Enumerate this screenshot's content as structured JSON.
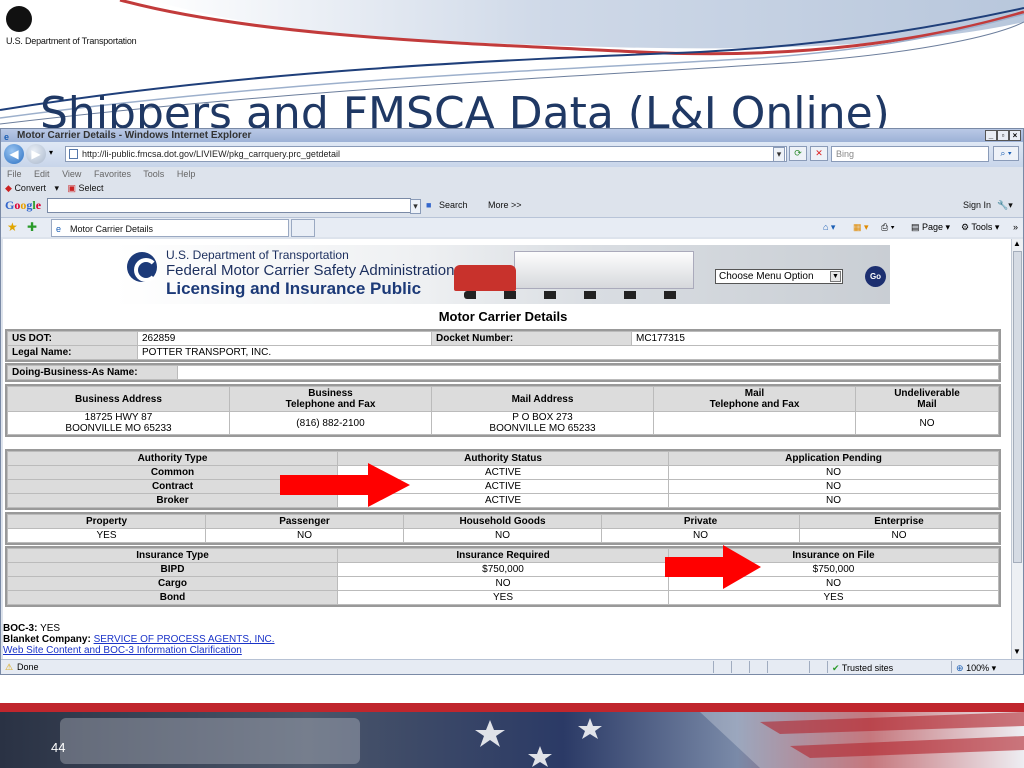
{
  "slide": {
    "org_label": "U.S. Department of Transportation",
    "title": "Shippers and FMSCA Data (L&I Online)",
    "page_number": "44"
  },
  "window": {
    "title": "Motor Carrier Details - Windows Internet Explorer",
    "url": "http://li-public.fmcsa.dot.gov/LIVIEW/pkg_carrquery.prc_getdetail",
    "search_placeholder": "Bing",
    "menu": [
      "File",
      "Edit",
      "View",
      "Favorites",
      "Tools",
      "Help"
    ],
    "convert_label": "Convert",
    "select_label": "Select",
    "google_logo": "Google",
    "google_search_label": "Search",
    "more_label": "More >>",
    "sign_in_label": "Sign In",
    "tab_label": "Motor Carrier Details",
    "page_menu_label": "Page",
    "tools_menu_label": "Tools",
    "status_done": "Done",
    "status_zone": "Trusted sites",
    "zoom": "100%"
  },
  "banner": {
    "dept": "U.S. Department of Transportation",
    "agency": "Federal Motor Carrier Safety Administration",
    "subtitle": "Licensing and Insurance Public",
    "menu_select": "Choose Menu Option",
    "go_label": "Go"
  },
  "page": {
    "heading": "Motor Carrier Details",
    "us_dot_label": "US DOT:",
    "us_dot": "262859",
    "docket_label": "Docket Number:",
    "docket": "MC177315",
    "legal_name_label": "Legal Name:",
    "legal_name": "POTTER TRANSPORT, INC.",
    "dba_label": "Doing-Business-As Name:",
    "dba": "",
    "address_headers": [
      "Business Address",
      "Business\nTelephone and Fax",
      "Mail Address",
      "Mail\nTelephone and Fax",
      "Undeliverable\nMail"
    ],
    "business_address": [
      "18725 HWY 87",
      "BOONVILLE MO 65233"
    ],
    "business_phone": "(816) 882-2100",
    "mail_address": [
      "P O BOX 273",
      "BOONVILLE MO 65233"
    ],
    "mail_phone": "",
    "undeliverable": "NO",
    "authority_headers": [
      "Authority Type",
      "Authority Status",
      "Application Pending"
    ],
    "authority_rows": [
      {
        "type": "Common",
        "status": "ACTIVE",
        "pending": "NO"
      },
      {
        "type": "Contract",
        "status": "ACTIVE",
        "pending": "NO"
      },
      {
        "type": "Broker",
        "status": "ACTIVE",
        "pending": "NO"
      }
    ],
    "cargo_headers": [
      "Property",
      "Passenger",
      "Household Goods",
      "Private",
      "Enterprise"
    ],
    "cargo_values": [
      "YES",
      "NO",
      "NO",
      "NO",
      "NO"
    ],
    "insurance_headers": [
      "Insurance Type",
      "Insurance Required",
      "Insurance on File"
    ],
    "insurance_rows": [
      {
        "type": "BIPD",
        "required": "$750,000",
        "on_file": "$750,000"
      },
      {
        "type": "Cargo",
        "required": "NO",
        "on_file": "NO"
      },
      {
        "type": "Bond",
        "required": "YES",
        "on_file": "YES"
      }
    ],
    "boc3_label": "BOC-3:",
    "boc3": "YES",
    "blanket_label": "Blanket Company:",
    "blanket_link": "SERVICE OF PROCESS AGENTS, INC.",
    "clarification_link": "Web Site Content and BOC-3 Information Clarification"
  },
  "colors": {
    "arrow": "#ff0000",
    "title": "#1f3864",
    "footer_red": "#c0262d"
  }
}
